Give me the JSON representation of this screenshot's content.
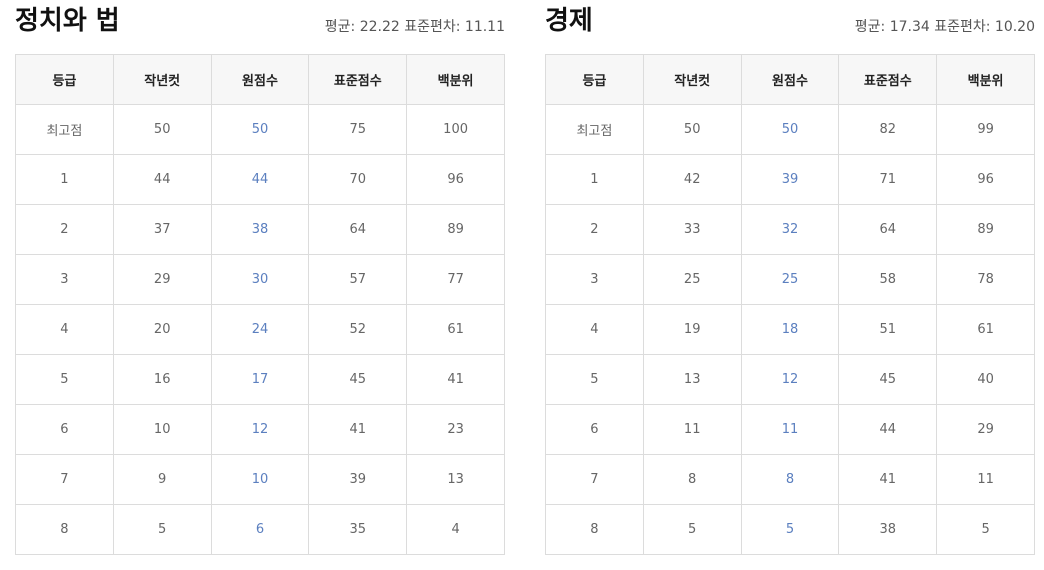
{
  "headers": [
    "등급",
    "작년컷",
    "원점수",
    "표준점수",
    "백분위"
  ],
  "panels": [
    {
      "title": "정치와 법",
      "stats": "평균: 22.22 표준편차: 11.11",
      "rows": [
        [
          "최고점",
          "50",
          "50",
          "75",
          "100"
        ],
        [
          "1",
          "44",
          "44",
          "70",
          "96"
        ],
        [
          "2",
          "37",
          "38",
          "64",
          "89"
        ],
        [
          "3",
          "29",
          "30",
          "57",
          "77"
        ],
        [
          "4",
          "20",
          "24",
          "52",
          "61"
        ],
        [
          "5",
          "16",
          "17",
          "45",
          "41"
        ],
        [
          "6",
          "10",
          "12",
          "41",
          "23"
        ],
        [
          "7",
          "9",
          "10",
          "39",
          "13"
        ],
        [
          "8",
          "5",
          "6",
          "35",
          "4"
        ]
      ]
    },
    {
      "title": "경제",
      "stats": "평균: 17.34 표준편차: 10.20",
      "rows": [
        [
          "최고점",
          "50",
          "50",
          "82",
          "99"
        ],
        [
          "1",
          "42",
          "39",
          "71",
          "96"
        ],
        [
          "2",
          "33",
          "32",
          "64",
          "89"
        ],
        [
          "3",
          "25",
          "25",
          "58",
          "78"
        ],
        [
          "4",
          "19",
          "18",
          "51",
          "61"
        ],
        [
          "5",
          "13",
          "12",
          "45",
          "40"
        ],
        [
          "6",
          "11",
          "11",
          "44",
          "29"
        ],
        [
          "7",
          "8",
          "8",
          "41",
          "11"
        ],
        [
          "8",
          "5",
          "5",
          "38",
          "5"
        ]
      ]
    }
  ],
  "colors": {
    "raw_score": "#5b7fbf",
    "header_bg": "#f7f7f7",
    "border": "#dcdcdc"
  }
}
